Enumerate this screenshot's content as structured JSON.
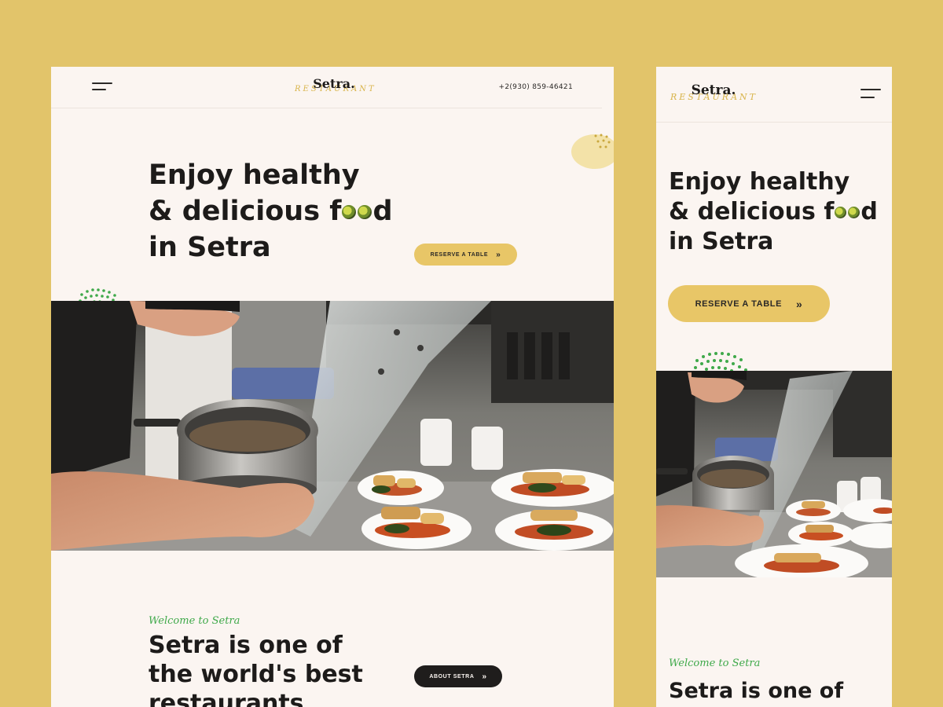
{
  "brand": {
    "name": "Setra.",
    "script": "RESTAURANT"
  },
  "header": {
    "phone": "+2(930) 859-46421"
  },
  "hero": {
    "headline_line1": "Enjoy healthy",
    "headline_line2_pre": "& delicious f",
    "headline_line2_post": "d",
    "headline_line3": "in Setra",
    "reserve_label": "RESERVE A TABLE",
    "chevron": "»"
  },
  "about": {
    "welcome": "Welcome to Setra",
    "line1": "Setra is one of",
    "line2": "the world's best",
    "line3": "restaurants",
    "button_label": "ABOUT SETRA",
    "chevron": "»"
  },
  "colors": {
    "background": "#e2c46a",
    "page": "#fbf5f1",
    "accent_yellow": "#e8c667",
    "accent_green": "#3fa94a",
    "dark": "#1f1d1c"
  },
  "icons": {
    "menu": "hamburger-menu-icon",
    "chevron": "double-chevron-right-icon"
  }
}
